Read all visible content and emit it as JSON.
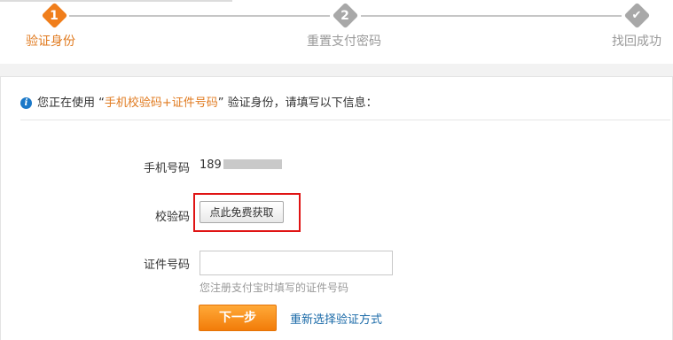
{
  "steps": [
    {
      "number": "1",
      "label": "验证身份"
    },
    {
      "number": "2",
      "label": "重置支付密码"
    },
    {
      "number": "✔",
      "label": "找回成功"
    }
  ],
  "notice": {
    "prefix": "您正在使用 “",
    "method": "手机校验码+证件号码",
    "suffix": "” 验证身份，请填写以下信息："
  },
  "form": {
    "phone_label": "手机号码",
    "phone_value": "189",
    "code_label": "校验码",
    "code_button": "点此免费获取",
    "id_label": "证件号码",
    "id_input_value": "",
    "id_hint": "您注册支付宝时填写的证件号码",
    "next_button": "下一步",
    "alt_link": "重新选择验证方式"
  },
  "colors": {
    "active_step": "#f07e1b",
    "inactive_step": "#a8a8a8",
    "highlight": "#e07a1f",
    "link": "#1a6aa8",
    "annotation_box": "#e01414"
  }
}
